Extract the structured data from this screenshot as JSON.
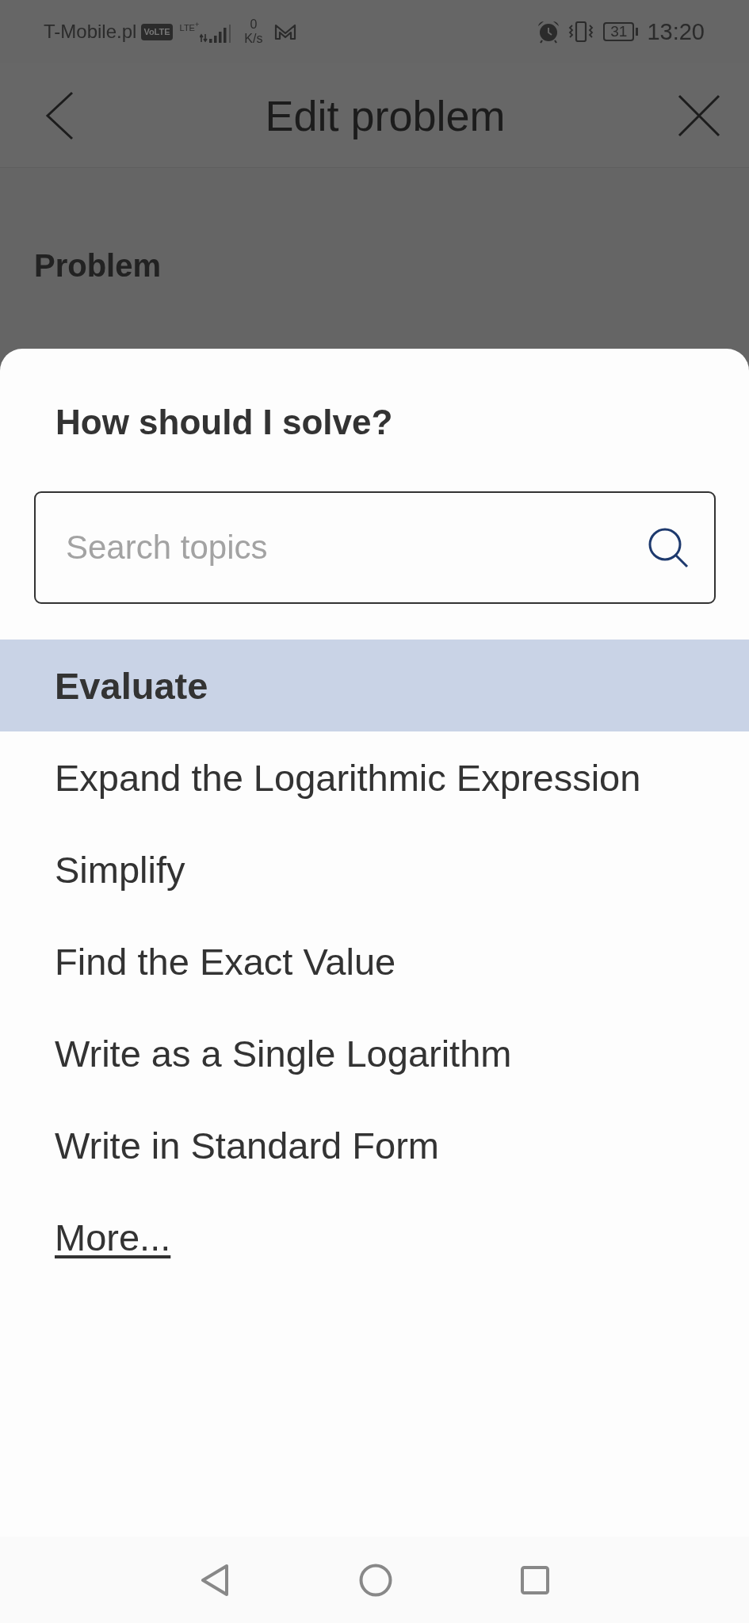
{
  "status_bar": {
    "carrier": "T-Mobile.pl",
    "volte": "VoLTE",
    "network": "LTE$^{+}$",
    "speed_value": "0",
    "speed_unit": "K/s",
    "battery": "31",
    "time": "13:20"
  },
  "header": {
    "title": "Edit problem"
  },
  "page": {
    "section_label": "Problem"
  },
  "sheet": {
    "title": "How should I solve?",
    "search": {
      "placeholder": "Search topics"
    },
    "topics": [
      {
        "label": "Evaluate",
        "selected": true
      },
      {
        "label": "Expand the Logarithmic Expression",
        "selected": false
      },
      {
        "label": "Simplify",
        "selected": false
      },
      {
        "label": "Find the Exact Value",
        "selected": false
      },
      {
        "label": "Write as a Single Logarithm",
        "selected": false
      },
      {
        "label": "Write in Standard Form",
        "selected": false
      }
    ],
    "more_link": "More..."
  }
}
